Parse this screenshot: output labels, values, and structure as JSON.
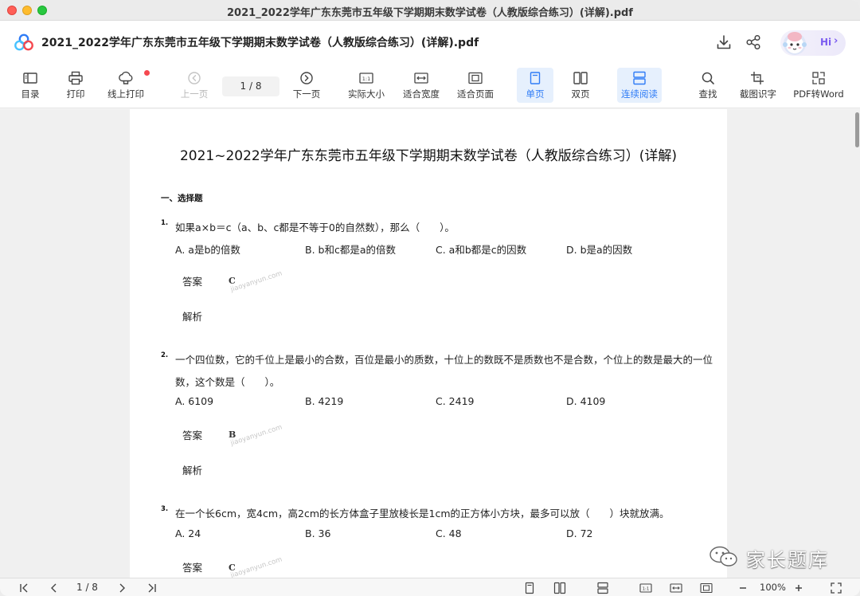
{
  "window": {
    "title": "2021_2022学年广东东莞市五年级下学期期末数学试卷（人教版综合练习）(详解).pdf"
  },
  "appbar": {
    "doc_title": "2021_2022学年广东东莞市五年级下学期期末数学试卷（人教版综合练习）(详解).pdf",
    "hi_label": "Hi",
    "icons": [
      "app-logo-icon",
      "download-icon",
      "share-icon",
      "assistant-avatar-icon"
    ]
  },
  "toolbar": {
    "contents": "目录",
    "print": "打印",
    "online_print": "线上打印",
    "prev_page": "上一页",
    "page_indicator": "1  /  8",
    "next_page": "下一页",
    "actual_size": "实际大小",
    "fit_width": "适合宽度",
    "fit_page": "适合页面",
    "single_page": "单页",
    "double_page": "双页",
    "continuous": "连续阅读",
    "find": "查找",
    "ocr": "截图识字",
    "pdf_to_word": "PDF转Word"
  },
  "document": {
    "title": "2021~2022学年广东东莞市五年级下学期期末数学试卷（人教版综合练习）(详解)",
    "section": "一、选择题",
    "answer_label": "答案",
    "analysis_label": "解析",
    "watermark": "jiaoyanyun.com",
    "questions": [
      {
        "num": "1.",
        "text": "如果a×b＝c（a、b、c都是不等于0的自然数），那么（　　）。",
        "options": [
          "A. a是b的倍数",
          "B. b和c都是a的倍数",
          "C. a和b都是c的因数",
          "D. b是a的因数"
        ],
        "answer": "C"
      },
      {
        "num": "2.",
        "text": "一个四位数，它的千位上是最小的合数，百位是最小的质数，十位上的数既不是质数也不是合数，个位上的数是最大的一位",
        "text2": "数，这个数是（　　）。",
        "options": [
          "A. 6109",
          "B. 4219",
          "C. 2419",
          "D. 4109"
        ],
        "answer": "B"
      },
      {
        "num": "3.",
        "text": "在一个长6cm，宽4cm，高2cm的长方体盒子里放棱长是1cm的正方体小方块，最多可以放（　　）块就放满。",
        "options": [
          "A. 24",
          "B. 36",
          "C. 48",
          "D. 72"
        ],
        "answer": "C"
      }
    ]
  },
  "brand": {
    "text": "家长题库"
  },
  "bottombar": {
    "page_indicator": "1  /  8",
    "zoom": "100%"
  }
}
